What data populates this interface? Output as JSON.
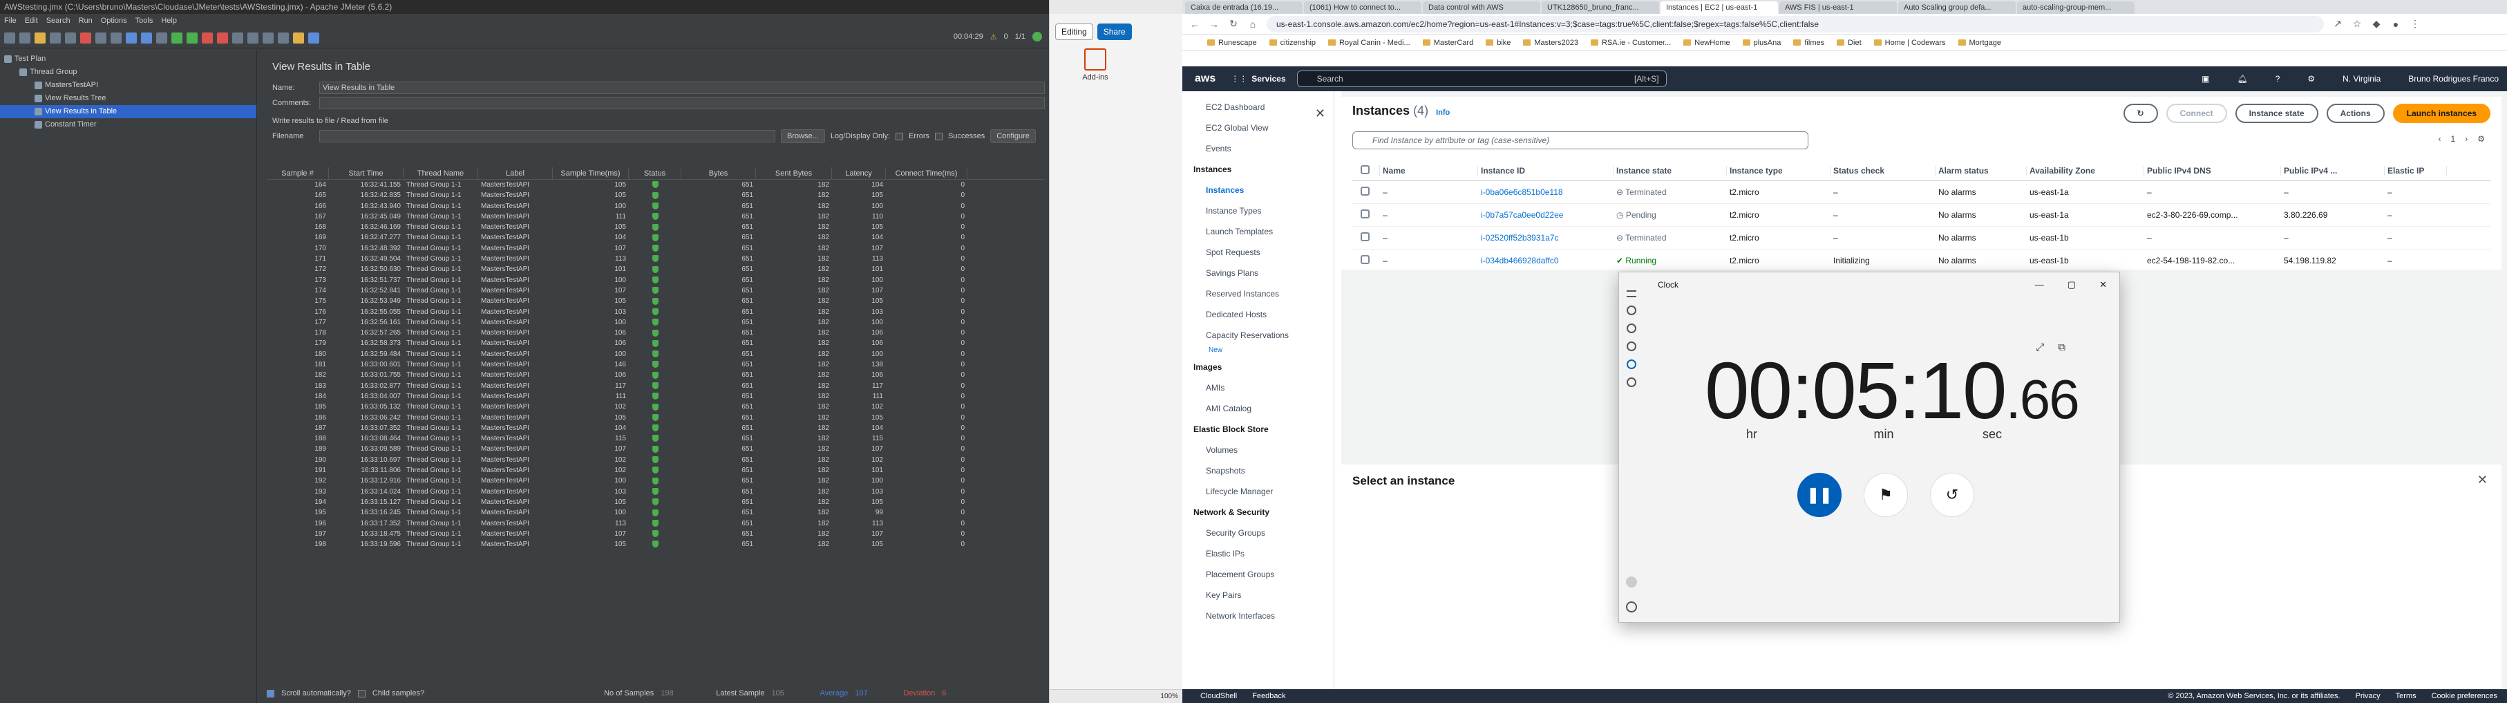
{
  "jmeter": {
    "title": "AWStesting.jmx (C:\\Users\\bruno\\Masters\\Cloudase\\JMeter\\tests\\AWStesting.jmx) - Apache JMeter (5.6.2)",
    "menu": [
      "File",
      "Edit",
      "Search",
      "Run",
      "Options",
      "Tools",
      "Help"
    ],
    "timer": "00:04:29",
    "threads": "1/1",
    "warn_count": "0",
    "tree": [
      {
        "label": "Test Plan",
        "indent": 0
      },
      {
        "label": "Thread Group",
        "indent": 1
      },
      {
        "label": "MastersTestAPI",
        "indent": 2
      },
      {
        "label": "View Results Tree",
        "indent": 2
      },
      {
        "label": "View Results in Table",
        "indent": 2,
        "selected": true
      },
      {
        "label": "Constant Timer",
        "indent": 2
      }
    ],
    "panel_title": "View Results in Table",
    "name_label": "Name:",
    "name_value": "View Results in Table",
    "comments_label": "Comments:",
    "write_label": "Write results to file / Read from file",
    "filename_label": "Filename",
    "browse": "Browse...",
    "log_only": "Log/Display Only:",
    "errors": "Errors",
    "successes": "Successes",
    "configure": "Configure",
    "columns": [
      "Sample #",
      "Start Time",
      "Thread Name",
      "Label",
      "Sample Time(ms)",
      "Status",
      "Bytes",
      "Sent Bytes",
      "Latency",
      "Connect Time(ms)"
    ],
    "rows": [
      [
        "164",
        "16:32:41.155",
        "Thread Group 1-1",
        "MastersTestAPI",
        "105",
        "651",
        "182",
        "104",
        "0"
      ],
      [
        "165",
        "16:32:42.835",
        "Thread Group 1-1",
        "MastersTestAPI",
        "105",
        "651",
        "182",
        "105",
        "0"
      ],
      [
        "166",
        "16:32:43.940",
        "Thread Group 1-1",
        "MastersTestAPI",
        "100",
        "651",
        "182",
        "100",
        "0"
      ],
      [
        "167",
        "16:32:45.049",
        "Thread Group 1-1",
        "MastersTestAPI",
        "111",
        "651",
        "182",
        "110",
        "0"
      ],
      [
        "168",
        "16:32:46.169",
        "Thread Group 1-1",
        "MastersTestAPI",
        "105",
        "651",
        "182",
        "105",
        "0"
      ],
      [
        "169",
        "16:32:47.277",
        "Thread Group 1-1",
        "MastersTestAPI",
        "104",
        "651",
        "182",
        "104",
        "0"
      ],
      [
        "170",
        "16:32:48.392",
        "Thread Group 1-1",
        "MastersTestAPI",
        "107",
        "651",
        "182",
        "107",
        "0"
      ],
      [
        "171",
        "16:32:49.504",
        "Thread Group 1-1",
        "MastersTestAPI",
        "113",
        "651",
        "182",
        "113",
        "0"
      ],
      [
        "172",
        "16:32:50.630",
        "Thread Group 1-1",
        "MastersTestAPI",
        "101",
        "651",
        "182",
        "101",
        "0"
      ],
      [
        "173",
        "16:32:51.737",
        "Thread Group 1-1",
        "MastersTestAPI",
        "100",
        "651",
        "182",
        "100",
        "0"
      ],
      [
        "174",
        "16:32:52.841",
        "Thread Group 1-1",
        "MastersTestAPI",
        "107",
        "651",
        "182",
        "107",
        "0"
      ],
      [
        "175",
        "16:32:53.949",
        "Thread Group 1-1",
        "MastersTestAPI",
        "105",
        "651",
        "182",
        "105",
        "0"
      ],
      [
        "176",
        "16:32:55.055",
        "Thread Group 1-1",
        "MastersTestAPI",
        "103",
        "651",
        "182",
        "103",
        "0"
      ],
      [
        "177",
        "16:32:56.161",
        "Thread Group 1-1",
        "MastersTestAPI",
        "100",
        "651",
        "182",
        "100",
        "0"
      ],
      [
        "178",
        "16:32:57.265",
        "Thread Group 1-1",
        "MastersTestAPI",
        "106",
        "651",
        "182",
        "106",
        "0"
      ],
      [
        "179",
        "16:32:58.373",
        "Thread Group 1-1",
        "MastersTestAPI",
        "106",
        "651",
        "182",
        "106",
        "0"
      ],
      [
        "180",
        "16:32:59.484",
        "Thread Group 1-1",
        "MastersTestAPI",
        "100",
        "651",
        "182",
        "100",
        "0"
      ],
      [
        "181",
        "16:33:00.601",
        "Thread Group 1-1",
        "MastersTestAPI",
        "146",
        "651",
        "182",
        "138",
        "0"
      ],
      [
        "182",
        "16:33:01.755",
        "Thread Group 1-1",
        "MastersTestAPI",
        "106",
        "651",
        "182",
        "106",
        "0"
      ],
      [
        "183",
        "16:33:02.877",
        "Thread Group 1-1",
        "MastersTestAPI",
        "117",
        "651",
        "182",
        "117",
        "0"
      ],
      [
        "184",
        "16:33:04.007",
        "Thread Group 1-1",
        "MastersTestAPI",
        "111",
        "651",
        "182",
        "111",
        "0"
      ],
      [
        "185",
        "16:33:05.132",
        "Thread Group 1-1",
        "MastersTestAPI",
        "102",
        "651",
        "182",
        "102",
        "0"
      ],
      [
        "186",
        "16:33:06.242",
        "Thread Group 1-1",
        "MastersTestAPI",
        "105",
        "651",
        "182",
        "105",
        "0"
      ],
      [
        "187",
        "16:33:07.352",
        "Thread Group 1-1",
        "MastersTestAPI",
        "104",
        "651",
        "182",
        "104",
        "0"
      ],
      [
        "188",
        "16:33:08.464",
        "Thread Group 1-1",
        "MastersTestAPI",
        "115",
        "651",
        "182",
        "115",
        "0"
      ],
      [
        "189",
        "16:33:09.589",
        "Thread Group 1-1",
        "MastersTestAPI",
        "107",
        "651",
        "182",
        "107",
        "0"
      ],
      [
        "190",
        "16:33:10.697",
        "Thread Group 1-1",
        "MastersTestAPI",
        "102",
        "651",
        "182",
        "102",
        "0"
      ],
      [
        "191",
        "16:33:11.806",
        "Thread Group 1-1",
        "MastersTestAPI",
        "102",
        "651",
        "182",
        "101",
        "0"
      ],
      [
        "192",
        "16:33:12.916",
        "Thread Group 1-1",
        "MastersTestAPI",
        "100",
        "651",
        "182",
        "100",
        "0"
      ],
      [
        "193",
        "16:33:14.024",
        "Thread Group 1-1",
        "MastersTestAPI",
        "103",
        "651",
        "182",
        "103",
        "0"
      ],
      [
        "194",
        "16:33:15.127",
        "Thread Group 1-1",
        "MastersTestAPI",
        "105",
        "651",
        "182",
        "105",
        "0"
      ],
      [
        "195",
        "16:33:16.245",
        "Thread Group 1-1",
        "MastersTestAPI",
        "100",
        "651",
        "182",
        "99",
        "0"
      ],
      [
        "196",
        "16:33:17.352",
        "Thread Group 1-1",
        "MastersTestAPI",
        "113",
        "651",
        "182",
        "113",
        "0"
      ],
      [
        "197",
        "16:33:18.475",
        "Thread Group 1-1",
        "MastersTestAPI",
        "107",
        "651",
        "182",
        "107",
        "0"
      ],
      [
        "198",
        "16:33:19.596",
        "Thread Group 1-1",
        "MastersTestAPI",
        "105",
        "651",
        "182",
        "105",
        "0"
      ]
    ],
    "scroll_auto": "Scroll automatically?",
    "child_samples": "Child samples?",
    "no_samples_label": "No of Samples",
    "no_samples": "198",
    "latest_label": "Latest Sample",
    "latest": "105",
    "average_label": "Average",
    "average": "107",
    "deviation_label": "Deviation",
    "deviation": "6"
  },
  "word": {
    "editing": "Editing",
    "share": "Share",
    "addins": "Add-ins",
    "zoom": "100%"
  },
  "browser": {
    "tabs": [
      "Caixa de entrada (16.19...",
      "(1061) How to connect to...",
      "Data control with AWS",
      "UTK128650_bruno_franc...",
      "Instances | EC2 | us-east-1",
      "AWS FIS | us-east-1",
      "Auto Scaling group defa...",
      "auto-scaling-group-mem..."
    ],
    "url": "us-east-1.console.aws.amazon.com/ec2/home?region=us-east-1#Instances:v=3;$case=tags:true%5C,client:false;$regex=tags:false%5C,client:false",
    "bookmarks": [
      "Runescape",
      "citizenship",
      "Royal Canin - Medi...",
      "MasterCard",
      "bike",
      "Masters2023",
      "RSA.ie - Customer...",
      "NewHome",
      "plusAna",
      "filmes",
      "Diet",
      "Home | Codewars",
      "Mortgage"
    ]
  },
  "aws": {
    "logo": "aws",
    "services": "Services",
    "search_placeholder": "Search",
    "search_hint": "[Alt+S]",
    "region": "N. Virginia",
    "user": "Bruno Rodrigues Franco",
    "sidebar": [
      {
        "t": "it",
        "label": "EC2 Dashboard"
      },
      {
        "t": "it",
        "label": "EC2 Global View"
      },
      {
        "t": "it",
        "label": "Events"
      },
      {
        "t": "sec",
        "label": "Instances"
      },
      {
        "t": "it",
        "label": "Instances",
        "active": true
      },
      {
        "t": "it",
        "label": "Instance Types"
      },
      {
        "t": "it",
        "label": "Launch Templates"
      },
      {
        "t": "it",
        "label": "Spot Requests"
      },
      {
        "t": "it",
        "label": "Savings Plans"
      },
      {
        "t": "it",
        "label": "Reserved Instances"
      },
      {
        "t": "it",
        "label": "Dedicated Hosts"
      },
      {
        "t": "it",
        "label": "Capacity Reservations"
      },
      {
        "t": "new",
        "label": "New"
      },
      {
        "t": "sec",
        "label": "Images"
      },
      {
        "t": "it",
        "label": "AMIs"
      },
      {
        "t": "it",
        "label": "AMI Catalog"
      },
      {
        "t": "sec",
        "label": "Elastic Block Store"
      },
      {
        "t": "it",
        "label": "Volumes"
      },
      {
        "t": "it",
        "label": "Snapshots"
      },
      {
        "t": "it",
        "label": "Lifecycle Manager"
      },
      {
        "t": "sec",
        "label": "Network & Security"
      },
      {
        "t": "it",
        "label": "Security Groups"
      },
      {
        "t": "it",
        "label": "Elastic IPs"
      },
      {
        "t": "it",
        "label": "Placement Groups"
      },
      {
        "t": "it",
        "label": "Key Pairs"
      },
      {
        "t": "it",
        "label": "Network Interfaces"
      }
    ],
    "instances_title": "Instances",
    "instances_count": "(4)",
    "info": "Info",
    "connect": "Connect",
    "instance_state": "Instance state",
    "actions": "Actions",
    "launch": "Launch instances",
    "filter_placeholder": "Find Instance by attribute or tag (case-sensitive)",
    "page": "1",
    "columns": [
      "",
      "Name",
      "Instance ID",
      "Instance state",
      "Instance type",
      "Status check",
      "Alarm status",
      "Availability Zone",
      "Public IPv4 DNS",
      "Public IPv4 ...",
      "Elastic IP"
    ],
    "rows": [
      [
        "",
        "–",
        "i-0ba06e6c851b0e118",
        "Terminated",
        "t2.micro",
        "–",
        "No alarms",
        "us-east-1a",
        "–",
        "–",
        "–"
      ],
      [
        "",
        "–",
        "i-0b7a57ca0ee0d22ee",
        "Pending",
        "t2.micro",
        "–",
        "No alarms",
        "us-east-1a",
        "ec2-3-80-226-69.comp...",
        "3.80.226.69",
        "–"
      ],
      [
        "",
        "–",
        "i-02520ff52b3931a7c",
        "Terminated",
        "t2.micro",
        "–",
        "No alarms",
        "us-east-1b",
        "–",
        "–",
        "–"
      ],
      [
        "",
        "–",
        "i-034db466928daffc0",
        "Running",
        "t2.micro",
        "Initializing",
        "No alarms",
        "us-east-1b",
        "ec2-54-198-119-82.co...",
        "54.198.119.82",
        "–"
      ]
    ],
    "select_instance": "Select an instance",
    "footer_left": [
      "CloudShell",
      "Feedback"
    ],
    "footer_right": [
      "© 2023, Amazon Web Services, Inc. or its affiliates.",
      "Privacy",
      "Terms",
      "Cookie preferences"
    ]
  },
  "clock": {
    "title": "Clock",
    "time_main": "00:05:10",
    "time_ms": ".66",
    "units": [
      "hr",
      "min",
      "sec"
    ]
  }
}
